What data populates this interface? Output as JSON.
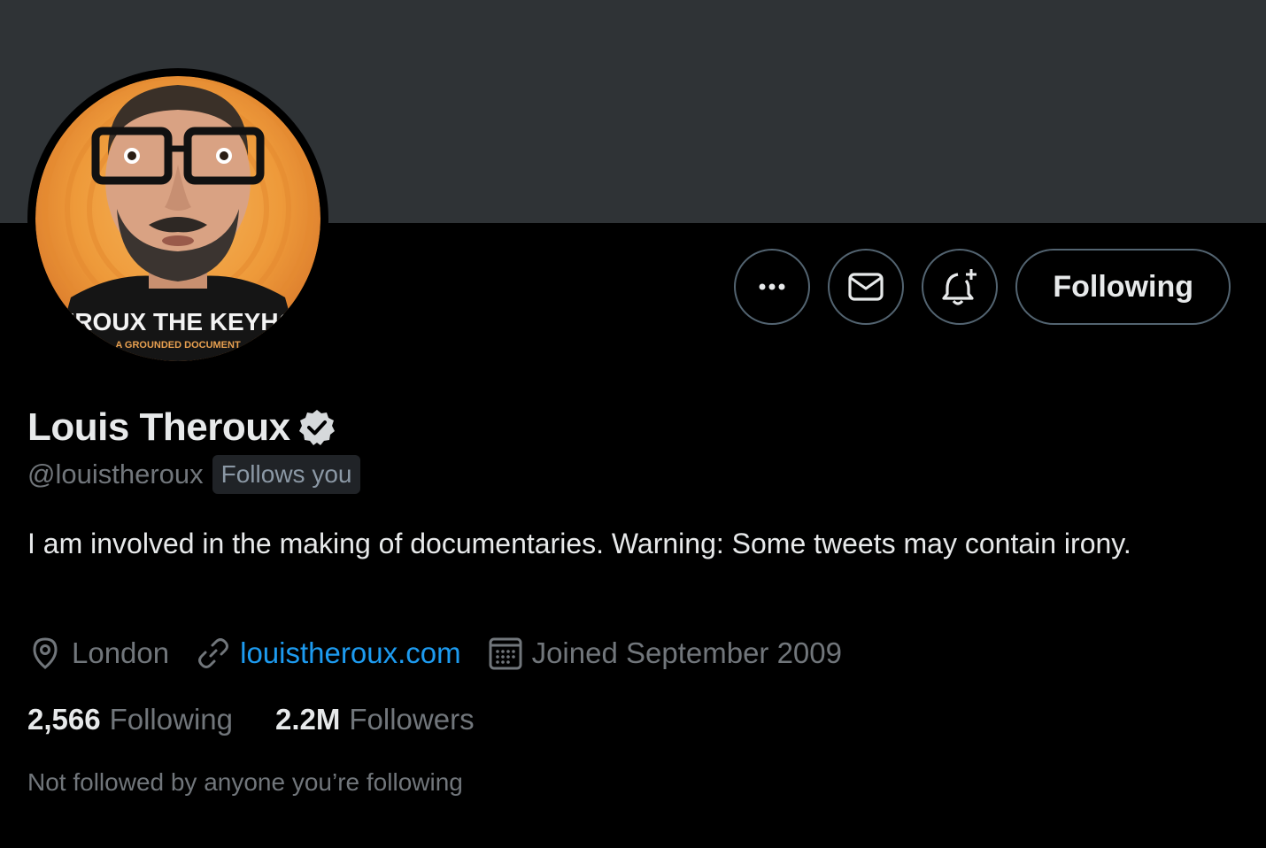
{
  "profile": {
    "name": "Louis Theroux",
    "handle": "@louistheroux",
    "follows_you_badge": "Follows you",
    "bio": "I am involved in the making of documentaries. Warning: Some tweets may contain irony.",
    "location": "London",
    "website": "louistheroux.com",
    "joined": "Joined September 2009",
    "following_count": "2,566",
    "following_label": "Following",
    "followers_count": "2.2M",
    "followers_label": "Followers",
    "mutual_note": "Not followed by anyone you’re following",
    "avatar_text_line1": "EROUX THE KEYHO",
    "avatar_text_line2": "A GROUNDED DOCUMENT"
  },
  "actions": {
    "more_icon": "more-icon",
    "message_icon": "envelope-icon",
    "notify_icon": "bell-plus-icon",
    "follow_label": "Following"
  },
  "icons": {
    "verified": "verified-badge-icon",
    "location": "location-pin-icon",
    "link": "link-icon",
    "calendar": "calendar-icon"
  },
  "colors": {
    "background": "#000000",
    "banner": "#2f3336",
    "text_primary": "#e7e9ea",
    "text_secondary": "#71767b",
    "link": "#1d9bf0",
    "border": "#536471",
    "avatar_orange": "#f0a040"
  }
}
